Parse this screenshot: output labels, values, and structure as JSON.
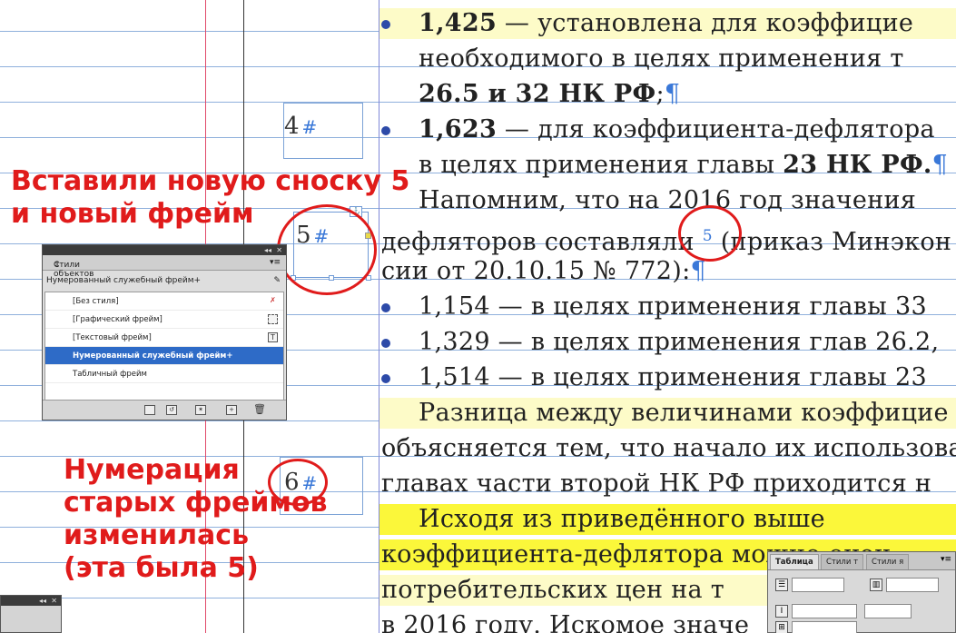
{
  "document": {
    "lines": [
      {
        "parts": [
          {
            "t": "1,425",
            "b": true
          },
          {
            "t": " — установлена для коэффицие"
          }
        ],
        "bullet": true,
        "hl": "light"
      },
      {
        "parts": [
          {
            "t": "необходимого в целях применения т"
          }
        ],
        "bullet": false,
        "hl": ""
      },
      {
        "parts": [
          {
            "t": "26.5 и 32 НК РФ",
            "b": true
          },
          {
            "t": ";"
          },
          {
            "t": "¶",
            "p": true
          }
        ],
        "bullet": false,
        "hl": ""
      },
      {
        "parts": [
          {
            "t": "1,623",
            "b": true
          },
          {
            "t": " — для коэффициента-дефлятора"
          }
        ],
        "bullet": true,
        "hl": ""
      },
      {
        "parts": [
          {
            "t": "в целях применения главы "
          },
          {
            "t": "23 НК РФ.",
            "b": true
          },
          {
            "t": "¶",
            "p": true
          }
        ],
        "bullet": false,
        "hl": ""
      },
      {
        "parts": [
          {
            "t": "Напомним, что на 2016 год значения"
          }
        ],
        "bullet": false,
        "hl": ""
      },
      {
        "parts": [
          {
            "t": "дефляторов составляли "
          },
          {
            "t": "5",
            "fn": true
          },
          {
            "t": " (приказ Минэкон"
          }
        ],
        "bullet": false,
        "hl": ""
      },
      {
        "parts": [
          {
            "t": "сии от 20.10.15 № 772):"
          },
          {
            "t": "¶",
            "p": true
          }
        ],
        "bullet": false,
        "hl": ""
      },
      {
        "parts": [
          {
            "t": "1,154 — в целях применения главы 33"
          }
        ],
        "bullet": true,
        "hl": ""
      },
      {
        "parts": [
          {
            "t": "1,329 — в целях применения глав 26.2,"
          }
        ],
        "bullet": true,
        "hl": ""
      },
      {
        "parts": [
          {
            "t": "1,514 — в целях применения главы 23"
          }
        ],
        "bullet": true,
        "hl": ""
      },
      {
        "parts": [
          {
            "t": "Разница между величинами коэффицие"
          }
        ],
        "bullet": false,
        "hl": "light"
      },
      {
        "parts": [
          {
            "t": "объясняется тем, что начало их использова"
          }
        ],
        "bullet": false,
        "hl": ""
      },
      {
        "parts": [
          {
            "t": "главах части второй НК РФ приходится н"
          }
        ],
        "bullet": false,
        "hl": ""
      },
      {
        "parts": [
          {
            "t": "Исходя из приведённого выше"
          }
        ],
        "bullet": false,
        "hl": "strong"
      },
      {
        "parts": [
          {
            "t": "коэффициента-дефлятора можно оцен"
          }
        ],
        "bullet": false,
        "hl": "strong"
      },
      {
        "parts": [
          {
            "t": "потребительских цен на т"
          }
        ],
        "bullet": false,
        "hl": "light"
      },
      {
        "parts": [
          {
            "t": "в 2016 году. Искомое значе"
          }
        ],
        "bullet": false,
        "hl": ""
      }
    ],
    "frames": [
      {
        "num": "4",
        "hash": "#"
      },
      {
        "num": "5",
        "hash": "#"
      },
      {
        "num": "6",
        "hash": "#"
      }
    ]
  },
  "annotations": {
    "new_footnote_line1": "Вставили новую сноску 5",
    "new_footnote_line2": "и новый фрейм",
    "renumber_line1": "Нумерация",
    "renumber_line2": "старых фреймов",
    "renumber_line3": "изменилась",
    "renumber_line4": "(эта была 5)"
  },
  "object_styles_panel": {
    "tab_title": "Стили объектов",
    "current_style": "Нумерованный служебный фрейм+",
    "items": [
      {
        "label": "[Без стиля]",
        "icon": "no-style-icon",
        "selected": false
      },
      {
        "label": "[Графический фрейм]",
        "icon": "graphic-frame-icon",
        "selected": false
      },
      {
        "label": "[Текстовый фрейм]",
        "icon": "text-frame-icon",
        "selected": false
      },
      {
        "label": "Нумерованный служебный фрейм+",
        "icon": "",
        "selected": true
      },
      {
        "label": "Табличный фрейм",
        "icon": "",
        "selected": false
      }
    ]
  },
  "table_panel": {
    "tabs": [
      "Таблица",
      "Стили т",
      "Стили я"
    ]
  },
  "colors": {
    "annotation_red": "#e01b1b",
    "highlight_light": "#fdfbc8",
    "highlight_strong": "#fbf73a",
    "guide_blue": "#8fb0dc",
    "selection_blue": "#2e6bc7"
  }
}
